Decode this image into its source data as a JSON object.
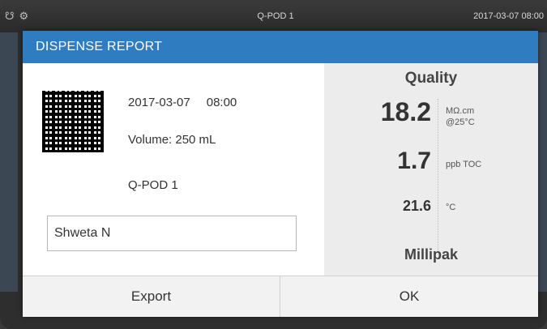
{
  "status_bar": {
    "device_name": "Q-POD 1",
    "datetime": "2017-03-07  08:00",
    "icons": [
      "network-icon",
      "usb-icon"
    ]
  },
  "dialog": {
    "title": "DISPENSE REPORT",
    "date": "2017-03-07",
    "time": "08:00",
    "volume": "Volume: 250 mL",
    "device": "Q-POD 1",
    "user_name": "Shweta N"
  },
  "quality": {
    "title": "Quality",
    "resistivity_value": "18.2",
    "resistivity_unit_line1": "MΩ.cm",
    "resistivity_unit_line2": "@25°C",
    "toc_value": "1.7",
    "toc_unit": "ppb TOC",
    "temperature_value": "21.6",
    "temperature_unit": "°C",
    "cartridge": "Millipak"
  },
  "buttons": {
    "export": "Export",
    "ok": "OK"
  },
  "colors": {
    "header": "#2f7cc1",
    "status_bar": "#2a2a2a"
  }
}
